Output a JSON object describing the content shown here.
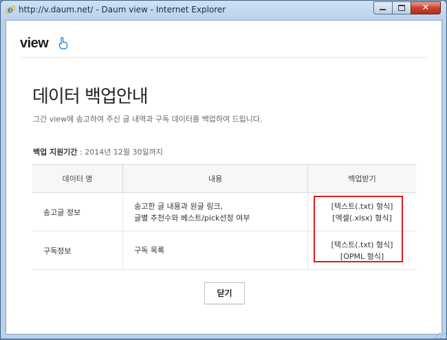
{
  "window": {
    "title": "http://v.daum.net/ - Daum view - Internet Explorer",
    "close_glyph": "✕"
  },
  "header": {
    "logo": "view"
  },
  "main": {
    "title": "데이터 백업안내",
    "subtitle": "그간 view에 송고하여 주신 글 내역과 구독 데이터를 백업하여 드립니다.",
    "period_label": "백업 지원기간",
    "period_value": " : 2014년 12월 30일까지"
  },
  "table": {
    "headers": [
      "데이터 명",
      "내용",
      "백업받기"
    ],
    "rows": [
      {
        "name": "송고글 정보",
        "content_line1": "송고한 글 내용과 원글 링크,",
        "content_line2": "글별 추천수와 베스트/pick선정 여부",
        "backup_line1": "[텍스트(.txt) 형식]",
        "backup_line2": "[엑셀(.xlsx) 형식]"
      },
      {
        "name": "구독정보",
        "content_line1": "구독 목록",
        "content_line2": "",
        "backup_line1": "[텍스트(.txt) 형식]",
        "backup_line2": "[OPML 형식]"
      }
    ]
  },
  "footer": {
    "close_label": "닫기"
  },
  "colors": {
    "highlight_border": "#e11b1b",
    "window_frame": "#b9d1ea"
  }
}
